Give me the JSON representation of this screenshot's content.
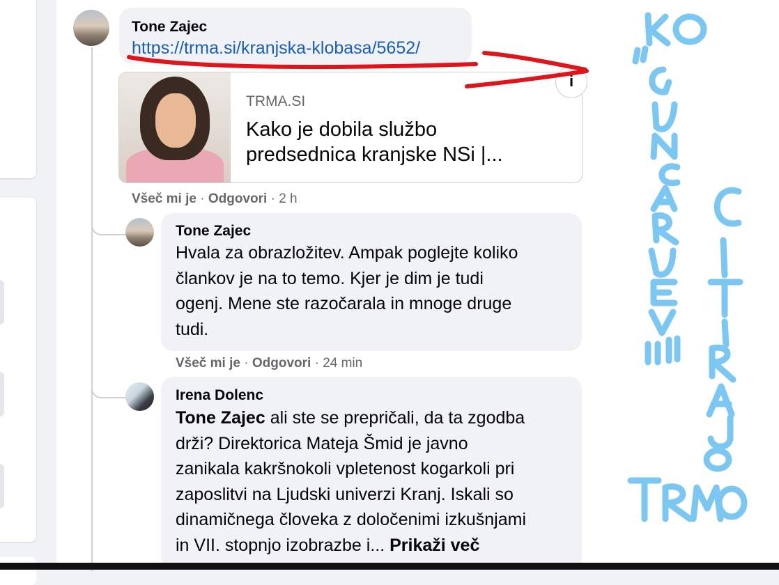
{
  "comments": [
    {
      "author": "Tone Zajec",
      "link": "https://trma.si/kranjska-klobasa/5652/",
      "link_preview": {
        "domain": "TRMA.SI",
        "title_line1": "Kako je dobila službo",
        "title_line2": "predsednica kranjske NSi |..."
      },
      "actions": {
        "like": "Všeč mi je",
        "reply": "Odgovori",
        "time": "2 h"
      }
    },
    {
      "author": "Tone Zajec",
      "text_lines": [
        "Hvala za obrazložitev. Ampak poglejte koliko",
        "člankov je na to temo. Kjer je dim je tudi",
        "ogenj. Mene ste razočarala in mnoge druge",
        "tudi."
      ],
      "actions": {
        "like": "Všeč mi je",
        "reply": "Odgovori",
        "time": "24 min"
      }
    },
    {
      "author": "Irena Dolenc",
      "mention": "Tone Zajec",
      "text_first_rest": " ali ste se prepričali, da ta zgodba",
      "text_lines": [
        "drži? Direktorica Mateja Šmid je javno",
        "zanikala kakršnokoli vpletenost kogarkoli pri",
        "zaposlitvi na Ljudski univerzi Kranj. Iskali so",
        "dinamičnega človeka z določenimi izkušnjami"
      ],
      "text_last": "in VII. stopnjo izobrazbe i... ",
      "see_more": "Prikaži več"
    }
  ],
  "side_buttons": [
    "e",
    "e",
    "e"
  ],
  "info_icon": "i",
  "annotation": {
    "handwritten_text": "KO\"GUNCARUEVI\" CITIRAJO TRMO",
    "ink_color": "#7cc7f2",
    "underline_color": "#e0151b"
  },
  "colors": {
    "link": "#1a5fb4",
    "bubble": "#f0f2f5",
    "meta": "#65676b"
  }
}
